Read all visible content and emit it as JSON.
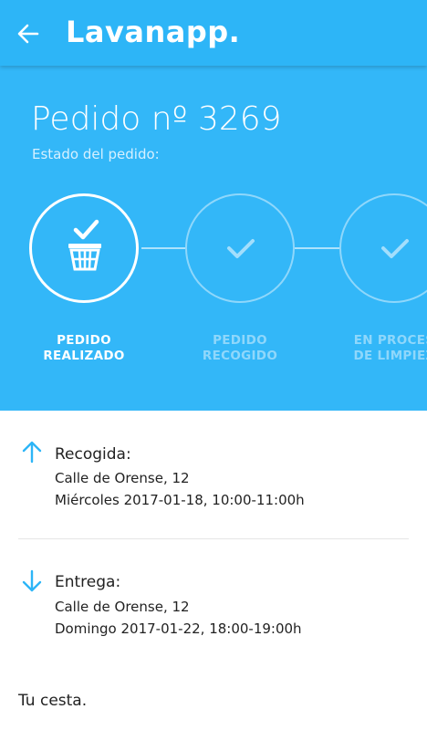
{
  "app": {
    "title": "Lavanapp."
  },
  "order": {
    "title": "Pedido nº 3269",
    "status_label": "Estado del pedido:"
  },
  "steps": [
    {
      "label_line1": "PEDIDO",
      "label_line2": "REALIZADO",
      "state": "done"
    },
    {
      "label_line1": "PEDIDO",
      "label_line2": "RECOGIDO",
      "state": "pending"
    },
    {
      "label_line1": "EN PROCES",
      "label_line2": "DE LIMPIEZ",
      "state": "pending"
    }
  ],
  "pickup": {
    "title": "Recogida:",
    "address": "Calle de Orense, 12",
    "datetime": "Miércoles 2017-01-18, 10:00-11:00h"
  },
  "delivery": {
    "title": "Entrega:",
    "address": "Calle de Orense, 12",
    "datetime": "Domingo 2017-01-22, 18:00-19:00h"
  },
  "basket": {
    "title": "Tu cesta."
  },
  "colors": {
    "brand": "#2db5f7",
    "accent": "#2db5f7"
  },
  "icons": {
    "back": "arrow-left-icon",
    "basket": "basket-icon",
    "check": "check-icon",
    "pickup": "arrow-up-icon",
    "delivery": "arrow-down-icon"
  }
}
